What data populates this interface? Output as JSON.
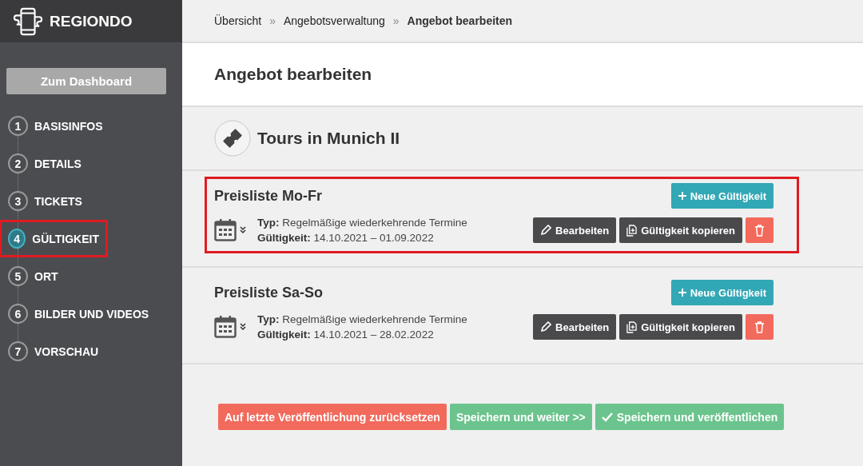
{
  "brand": {
    "name": "REGIONDO"
  },
  "dashboard_button": "Zum Dashboard",
  "steps": [
    {
      "number": "1",
      "label": "BASISINFOS",
      "selected": false,
      "highlighted": false
    },
    {
      "number": "2",
      "label": "DETAILS",
      "selected": false,
      "highlighted": false
    },
    {
      "number": "3",
      "label": "TICKETS",
      "selected": false,
      "highlighted": false
    },
    {
      "number": "4",
      "label": "GÜLTIGKEIT",
      "selected": true,
      "highlighted": true
    },
    {
      "number": "5",
      "label": "ORT",
      "selected": false,
      "highlighted": false
    },
    {
      "number": "6",
      "label": "BILDER UND VIDEOS",
      "selected": false,
      "highlighted": false
    },
    {
      "number": "7",
      "label": "VORSCHAU",
      "selected": false,
      "highlighted": false
    }
  ],
  "breadcrumbs": [
    {
      "kind": "link",
      "text": "Übersicht"
    },
    {
      "kind": "sep",
      "text": "»"
    },
    {
      "kind": "link",
      "text": "Angebotsverwaltung"
    },
    {
      "kind": "sep",
      "text": "»"
    },
    {
      "kind": "current",
      "text": "Angebot bearbeiten"
    }
  ],
  "page_title": "Angebot bearbeiten",
  "product_title": "Tours in Munich II",
  "price_lists": [
    {
      "title": "Preisliste Mo-Fr",
      "highlighted": true,
      "type_label": "Typ:",
      "type": "Regelmäßige wiederkehrende Termine",
      "validity_label": "Gültigkeit:",
      "validity": "14.10.2021 – 01.09.2022",
      "new_button": "Neue Gültigkeit",
      "edit_button": "Bearbeiten",
      "copy_button": "Gültigkeit kopieren"
    },
    {
      "title": "Preisliste Sa-So",
      "highlighted": false,
      "type_label": "Typ:",
      "type": "Regelmäßige wiederkehrende Termine",
      "validity_label": "Gültigkeit:",
      "validity": "14.10.2021 – 28.02.2022",
      "new_button": "Neue Gültigkeit",
      "edit_button": "Bearbeiten",
      "copy_button": "Gültigkeit kopieren"
    }
  ],
  "footer_buttons": [
    {
      "kind": "reset",
      "label": "Auf letzte Veröffentlichung zurücksetzen"
    },
    {
      "kind": "next",
      "label": "Speichern und weiter >>"
    },
    {
      "kind": "publish",
      "label": "Speichern und veröffentlichen"
    }
  ]
}
